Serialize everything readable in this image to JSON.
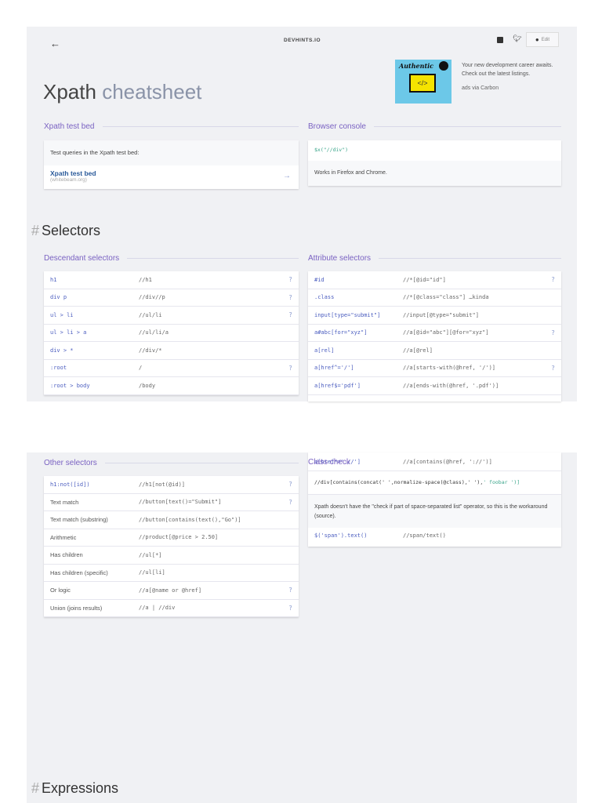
{
  "header": {
    "brand": "DEVHINTS.IO",
    "edit_label": "Edit"
  },
  "title": {
    "main": "Xpath",
    "sub": "cheatsheet"
  },
  "ad": {
    "text": "Your new development career awaits. Check out the latest listings.",
    "via": "ads via Carbon",
    "image_text": "Authentic"
  },
  "testbed": {
    "heading": "Xpath test bed",
    "intro": "Test queries in the Xpath test bed:",
    "link": "Xpath test bed",
    "domain": "(whitebeam.org)"
  },
  "console": {
    "heading": "Browser console",
    "code": "$x(\"//div\")",
    "note": "Works in Firefox and Chrome."
  },
  "selectors": {
    "hash": "#",
    "heading": "Selectors"
  },
  "descendant": {
    "heading": "Descendant selectors",
    "rows": [
      {
        "css": "h1",
        "xpath": "//h1",
        "q": "?"
      },
      {
        "css": "div p",
        "xpath": "//div//p",
        "q": "?"
      },
      {
        "css": "ul > li",
        "xpath": "//ul/li",
        "q": "?"
      },
      {
        "css": "ul > li > a",
        "xpath": "//ul/li/a",
        "q": ""
      },
      {
        "css": "div > *",
        "xpath": "//div/*",
        "q": ""
      },
      {
        "css": ":root",
        "xpath": "/",
        "q": "?"
      },
      {
        "css": ":root > body",
        "xpath": "/body",
        "q": ""
      }
    ]
  },
  "attribute": {
    "heading": "Attribute selectors",
    "rows": [
      {
        "css": "#id",
        "xpath": "//*[@id=\"id\"]",
        "q": "?"
      },
      {
        "css": ".class",
        "xpath": "//*[@class=\"class\"] …kinda",
        "q": ""
      },
      {
        "css": "input[type=\"submit\"]",
        "xpath": "//input[@type=\"submit\"]",
        "q": ""
      },
      {
        "css": "a#abc[for=\"xyz\"]",
        "xpath": "//a[@id=\"abc\"][@for=\"xyz\"]",
        "q": "?"
      },
      {
        "css": "a[rel]",
        "xpath": "//a[@rel]",
        "q": ""
      },
      {
        "css": "a[href^='/']",
        "xpath": "//a[starts-with(@href, '/')]",
        "q": "?"
      },
      {
        "css": "a[href$='pdf']",
        "xpath": "//a[ends-with(@href, '.pdf')]",
        "q": ""
      }
    ]
  },
  "other": {
    "heading": "Other selectors",
    "rows": [
      {
        "css": "h1:not([id])",
        "xpath": "//h1[not(@id)]",
        "q": "?",
        "code": true
      },
      {
        "css": "Text match",
        "xpath": "//button[text()=\"Submit\"]",
        "q": "?"
      },
      {
        "css": "Text match (substring)",
        "xpath": "//button[contains(text(),\"Go\")]",
        "q": ""
      },
      {
        "css": "Arithmetic",
        "xpath": "//product[@price > 2.50]",
        "q": ""
      },
      {
        "css": "Has children",
        "xpath": "//ul[*]",
        "q": ""
      },
      {
        "css": "Has children (specific)",
        "xpath": "//ul[li]",
        "q": ""
      },
      {
        "css": "Or logic",
        "xpath": "//a[@name or @href]",
        "q": "?"
      },
      {
        "css": "Union (joins results)",
        "xpath": "//a | //div",
        "q": "?"
      }
    ]
  },
  "classcheck": {
    "heading": "Class check",
    "overlap_css": "a[href*='://']",
    "overlap_xpath": "//a[contains(@href, '://')]",
    "code_a": "//div[contains(concat(' ',normalize-space(@class),' '),",
    "code_b": "' foobar ')]",
    "note": "Xpath doesn't have the \"check if part of space-separated list\" operator, so this is the workaround (source).",
    "extra_css": "$('span').text()",
    "extra_xpath": "//span/text()"
  },
  "expressions": {
    "hash": "#",
    "heading": "Expressions"
  }
}
